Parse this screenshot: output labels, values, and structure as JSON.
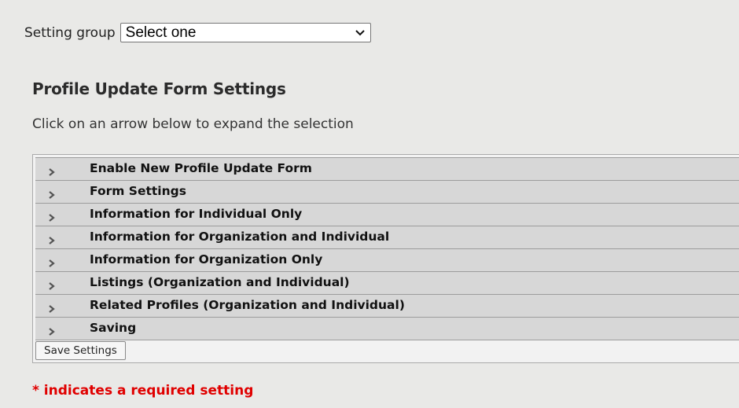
{
  "setting_group": {
    "label": "Setting group",
    "selected": "Select one"
  },
  "page_title": "Profile Update Form Settings",
  "instructions": "Click on an arrow below to expand the selection",
  "sections": [
    {
      "label": "Enable New Profile Update Form"
    },
    {
      "label": "Form Settings"
    },
    {
      "label": "Information for Individual Only"
    },
    {
      "label": "Information for Organization and Individual"
    },
    {
      "label": "Information for Organization Only"
    },
    {
      "label": "Listings (Organization and Individual)"
    },
    {
      "label": "Related Profiles (Organization and Individual)"
    },
    {
      "label": "Saving"
    }
  ],
  "save_button_label": "Save Settings",
  "required_note": "* indicates a required setting",
  "icons": {
    "row_arrow": "chevron-right-icon",
    "select_arrow": "chevron-down-icon"
  },
  "colors": {
    "background": "#e9e9e7",
    "row_background": "#d7d7d7",
    "required_text": "#e00000"
  }
}
